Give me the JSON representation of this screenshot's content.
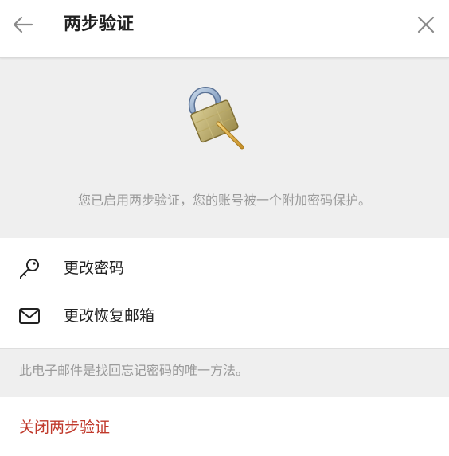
{
  "header": {
    "title": "两步验证",
    "back_icon": "arrow-left-icon",
    "close_icon": "close-icon"
  },
  "hero": {
    "icon": "padlock-with-key-icon",
    "description": "您已启用两步验证，您的账号被一个附加密码保护。"
  },
  "menu": {
    "items": [
      {
        "label": "更改密码",
        "icon": "key-icon"
      },
      {
        "label": "更改恢复邮箱",
        "icon": "envelope-icon"
      }
    ]
  },
  "note": {
    "text": "此电子邮件是找回忘记密码的唯一方法。"
  },
  "disable": {
    "label": "关闭两步验证",
    "color": "#c0392b"
  }
}
